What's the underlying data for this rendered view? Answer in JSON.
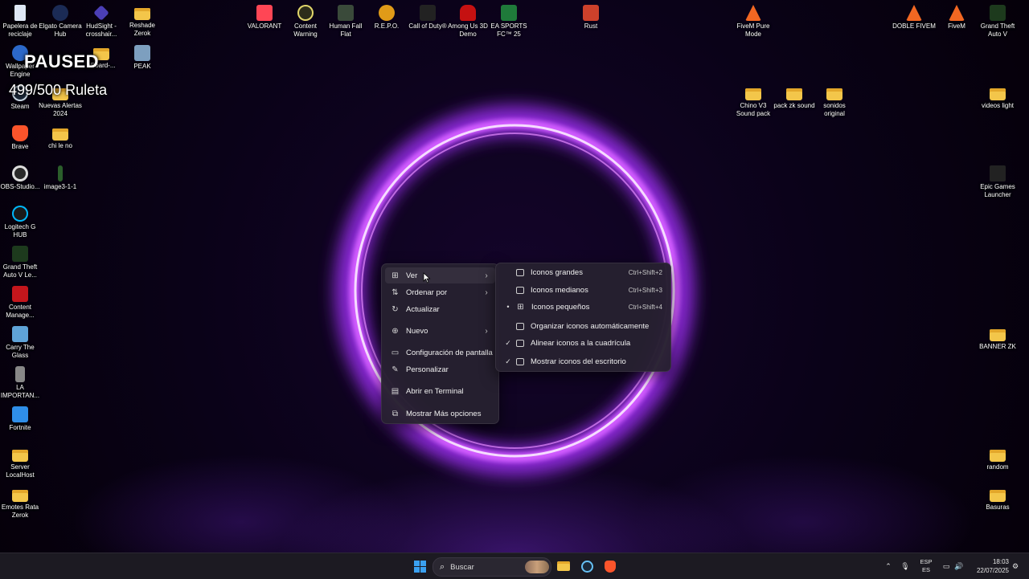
{
  "overlay": {
    "paused": "PAUSED",
    "ruleta": "499/500 Ruleta"
  },
  "desktop": {
    "left_col": [
      {
        "label": "Papelera de reciclaje",
        "icon": "recycle-bin-icon"
      },
      {
        "label": "Wallpaper Engine",
        "icon": "wallpaper-engine-icon"
      },
      {
        "label": "Steam",
        "icon": "steam-icon"
      },
      {
        "label": "Brave",
        "icon": "brave-icon"
      },
      {
        "label": "OBS-Studio...",
        "icon": "obs-icon"
      },
      {
        "label": "Logitech G HUB",
        "icon": "logitech-icon"
      },
      {
        "label": "Grand Theft Auto V Le...",
        "icon": "gta-icon"
      },
      {
        "label": "Content Manage...",
        "icon": "content-manager-icon"
      },
      {
        "label": "Carry The Glass",
        "icon": "game-icon"
      },
      {
        "label": "LA IMPORTAN...",
        "icon": "document-icon"
      },
      {
        "label": "Fortnite",
        "icon": "fortnite-icon"
      },
      {
        "label": "Server LocalHost",
        "icon": "folder-icon"
      },
      {
        "label": "Emotes Rata Zerok",
        "icon": "folder-icon"
      }
    ],
    "second_col": [
      {
        "label": "Elgato Camera Hub",
        "icon": "elgato-icon"
      },
      {
        "label": "Nuevas Alertas 2024",
        "icon": "folder-icon"
      },
      {
        "label": "chi le no",
        "icon": "folder-icon"
      },
      {
        "label": "image3-1-1",
        "icon": "image-icon"
      }
    ],
    "third_col": [
      {
        "label": "HudSight - crosshair...",
        "icon": "hudsight-icon"
      },
      {
        "label": "nBoard-...",
        "icon": "folder-icon"
      }
    ],
    "fourth_col": [
      {
        "label": "Reshade Zerok",
        "icon": "folder-icon"
      },
      {
        "label": "PEAK",
        "icon": "peak-icon"
      }
    ],
    "top_row": [
      {
        "label": "VALORANT",
        "icon": "valorant-icon"
      },
      {
        "label": "Content Warning",
        "icon": "content-warning-icon"
      },
      {
        "label": "Human Fall Flat",
        "icon": "human-fall-flat-icon"
      },
      {
        "label": "R.E.P.O.",
        "icon": "repo-icon"
      },
      {
        "label": "Call of Duty®",
        "icon": "cod-icon"
      },
      {
        "label": "Among Us 3D Demo",
        "icon": "among-us-icon"
      },
      {
        "label": "EA SPORTS FC™ 25",
        "icon": "ea-sports-icon"
      },
      {
        "label": "Rust",
        "icon": "rust-icon"
      }
    ],
    "right_area": [
      {
        "label": "FiveM Pure Mode",
        "icon": "fivem-icon"
      },
      {
        "label": "DOBLE FIVEM",
        "icon": "fivem-icon"
      },
      {
        "label": "FiveM",
        "icon": "fivem-icon"
      },
      {
        "label": "Grand Theft Auto V",
        "icon": "gta-icon"
      },
      {
        "label": "Chino V3 Sound pack",
        "icon": "folder-icon"
      },
      {
        "label": "pack zk sound",
        "icon": "folder-icon"
      },
      {
        "label": "sonidos original",
        "icon": "folder-icon"
      },
      {
        "label": "videos light",
        "icon": "folder-icon"
      },
      {
        "label": "Epic Games Launcher",
        "icon": "epic-icon"
      },
      {
        "label": "BANNER ZK",
        "icon": "folder-icon"
      },
      {
        "label": "random",
        "icon": "folder-icon"
      },
      {
        "label": "Basuras",
        "icon": "folder-icon"
      }
    ]
  },
  "context_menu": {
    "items": [
      {
        "label": "Ver",
        "icon": "grid-icon",
        "submenu": true
      },
      {
        "label": "Ordenar por",
        "icon": "sort-icon",
        "submenu": true
      },
      {
        "label": "Actualizar",
        "icon": "refresh-icon"
      },
      {
        "label": "Nuevo",
        "icon": "plus-circle-icon",
        "submenu": true
      },
      {
        "label": "Configuración de pantalla",
        "icon": "display-icon"
      },
      {
        "label": "Personalizar",
        "icon": "pen-icon"
      },
      {
        "label": "Abrir en Terminal",
        "icon": "terminal-icon"
      },
      {
        "label": "Mostrar Más opciones",
        "icon": "more-options-icon"
      }
    ]
  },
  "submenu_ver": {
    "items": [
      {
        "label": "Iconos grandes",
        "shortcut": "Ctrl+Shift+2",
        "mark": ""
      },
      {
        "label": "Iconos medianos",
        "shortcut": "Ctrl+Shift+3",
        "mark": ""
      },
      {
        "label": "Iconos pequeños",
        "shortcut": "Ctrl+Shift+4",
        "mark": "•"
      },
      {
        "label": "Organizar iconos automáticamente",
        "shortcut": "",
        "mark": ""
      },
      {
        "label": "Alinear iconos a la cuadrícula",
        "shortcut": "",
        "mark": "✓"
      },
      {
        "label": "Mostrar iconos del escritorio",
        "shortcut": "",
        "mark": "✓"
      }
    ]
  },
  "taskbar": {
    "search_placeholder": "Buscar",
    "lang_top": "ESP",
    "lang_bottom": "ES",
    "time": "18:03",
    "date": "22/07/2025"
  },
  "colors": {
    "ring": "#c23cff",
    "ring_core": "#f4d8ff",
    "accent": "#3aa0f0"
  }
}
